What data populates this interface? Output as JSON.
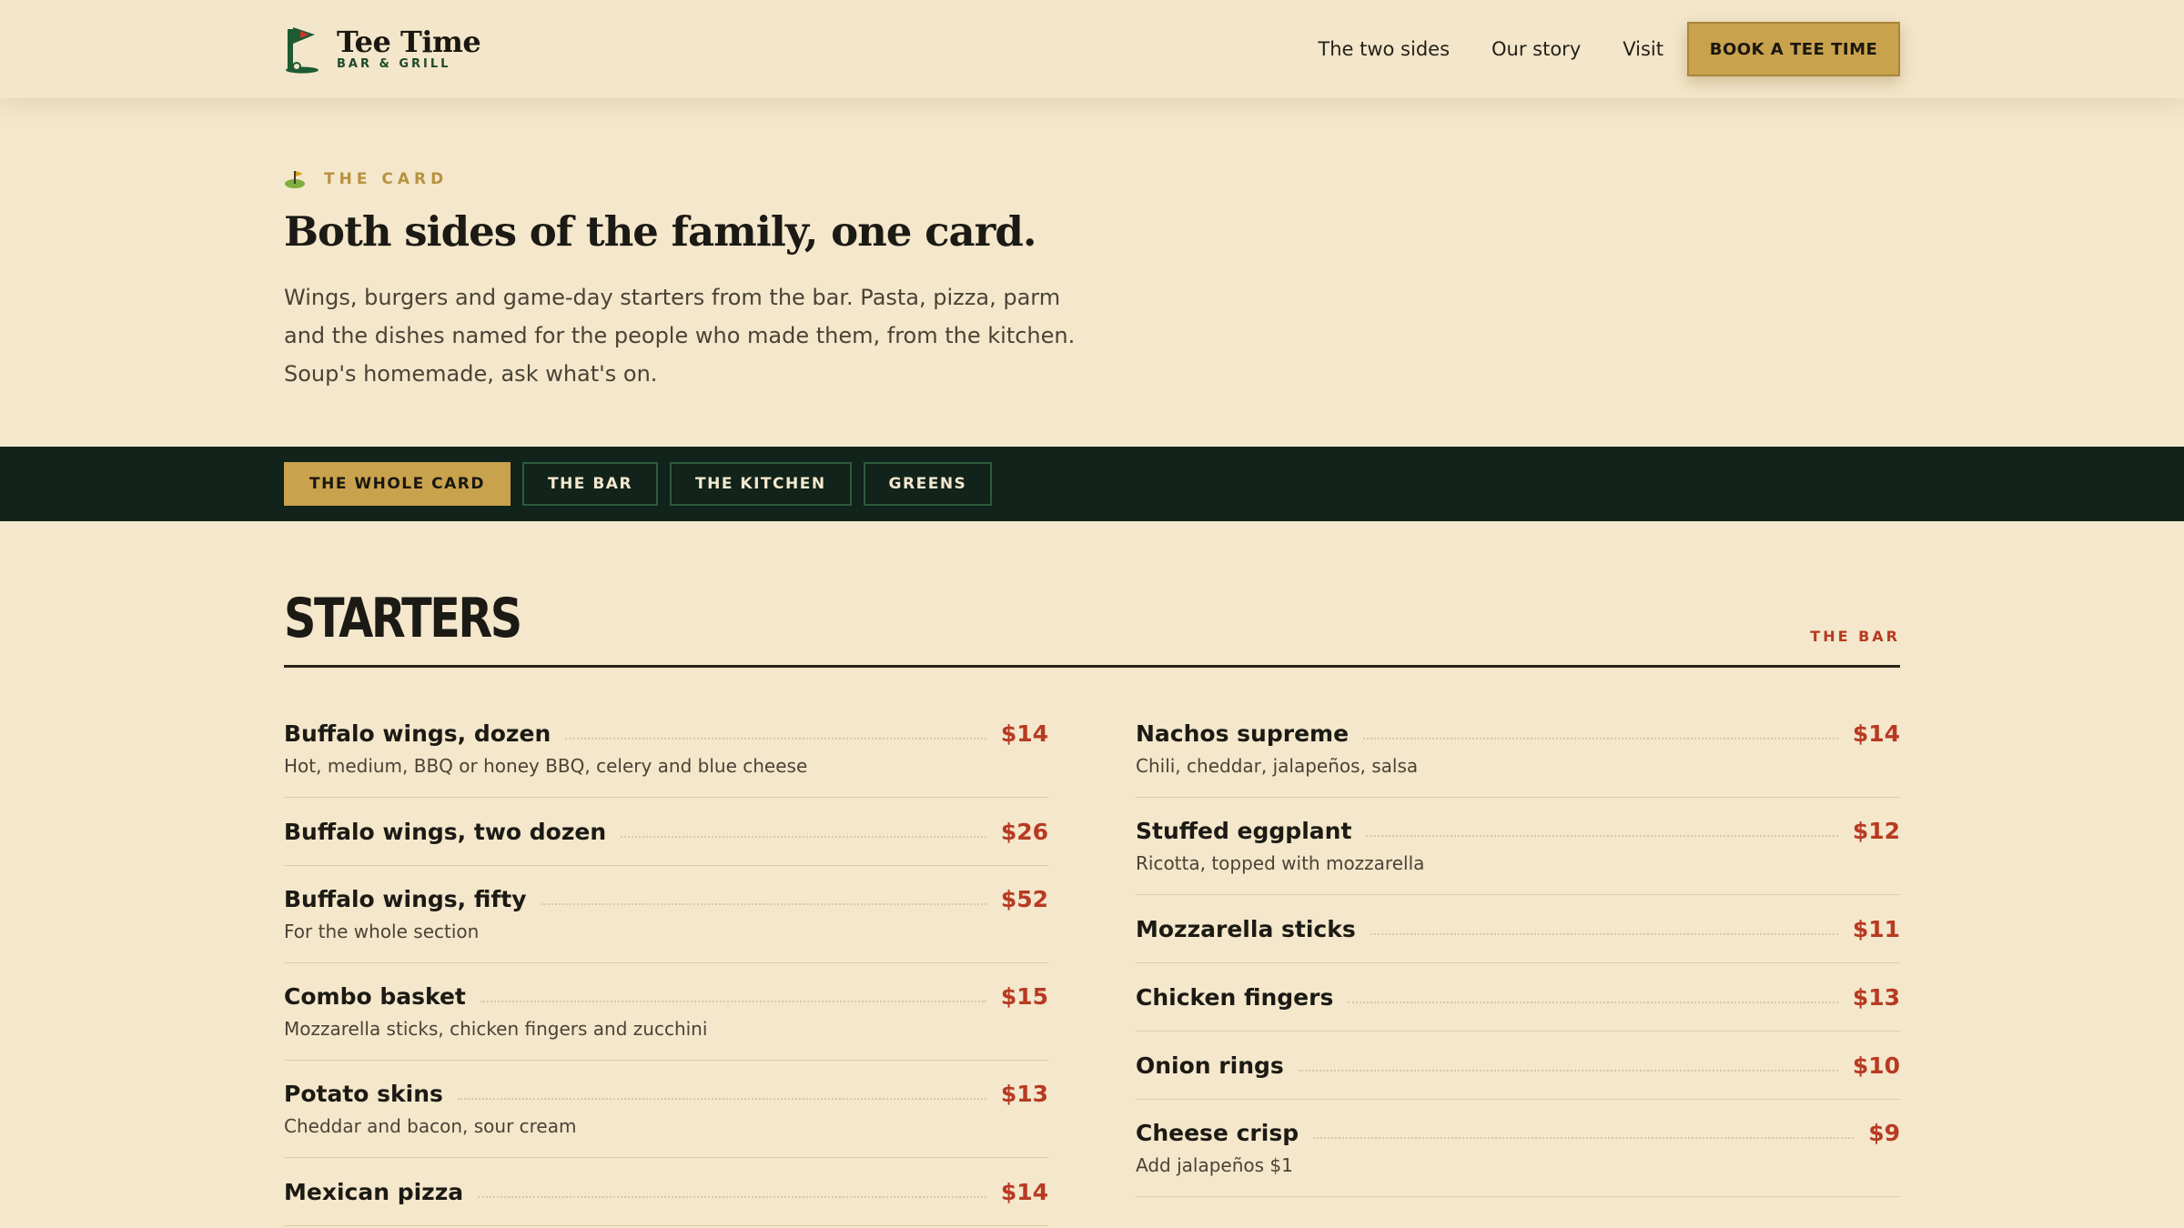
{
  "header": {
    "brand_name": "Tee Time",
    "brand_sub": "BAR & GRILL",
    "nav": [
      "The two sides",
      "Our story",
      "Visit"
    ],
    "cta": "BOOK A TEE TIME"
  },
  "intro": {
    "eyebrow": "THE CARD",
    "title": "Both sides of the family, one card.",
    "description": "Wings, burgers and game-day starters from the bar. Pasta, pizza, parm and the dishes named for the people who made them, from the kitchen. Soup's homemade, ask what's on."
  },
  "filters": [
    {
      "label": "THE WHOLE CARD",
      "active": true
    },
    {
      "label": "THE BAR",
      "active": false
    },
    {
      "label": "THE KITCHEN",
      "active": false
    },
    {
      "label": "GREENS",
      "active": false
    }
  ],
  "section": {
    "title": "STARTERS",
    "tag": "THE BAR",
    "left_items": [
      {
        "name": "Buffalo wings, dozen",
        "price": "$14",
        "desc": "Hot, medium, BBQ or honey BBQ, celery and blue cheese"
      },
      {
        "name": "Buffalo wings, two dozen",
        "price": "$26",
        "desc": ""
      },
      {
        "name": "Buffalo wings, fifty",
        "price": "$52",
        "desc": "For the whole section"
      },
      {
        "name": "Combo basket",
        "price": "$15",
        "desc": "Mozzarella sticks, chicken fingers and zucchini"
      },
      {
        "name": "Potato skins",
        "price": "$13",
        "desc": "Cheddar and bacon, sour cream"
      },
      {
        "name": "Mexican pizza",
        "price": "$14",
        "desc": ""
      }
    ],
    "right_items": [
      {
        "name": "Nachos supreme",
        "price": "$14",
        "desc": "Chili, cheddar, jalapeños, salsa"
      },
      {
        "name": "Stuffed eggplant",
        "price": "$12",
        "desc": "Ricotta, topped with mozzarella"
      },
      {
        "name": "Mozzarella sticks",
        "price": "$11",
        "desc": ""
      },
      {
        "name": "Chicken fingers",
        "price": "$13",
        "desc": ""
      },
      {
        "name": "Onion rings",
        "price": "$10",
        "desc": ""
      },
      {
        "name": "Cheese crisp",
        "price": "$9",
        "desc": "Add jalapeños $1"
      }
    ]
  },
  "colors": {
    "background": "#f4e7cb",
    "accent_gold": "#c9a24d",
    "price_red": "#b83a22",
    "dark_green": "#11231a"
  },
  "icons": [
    "golf-flag-icon",
    "golf-hole-icon"
  ]
}
